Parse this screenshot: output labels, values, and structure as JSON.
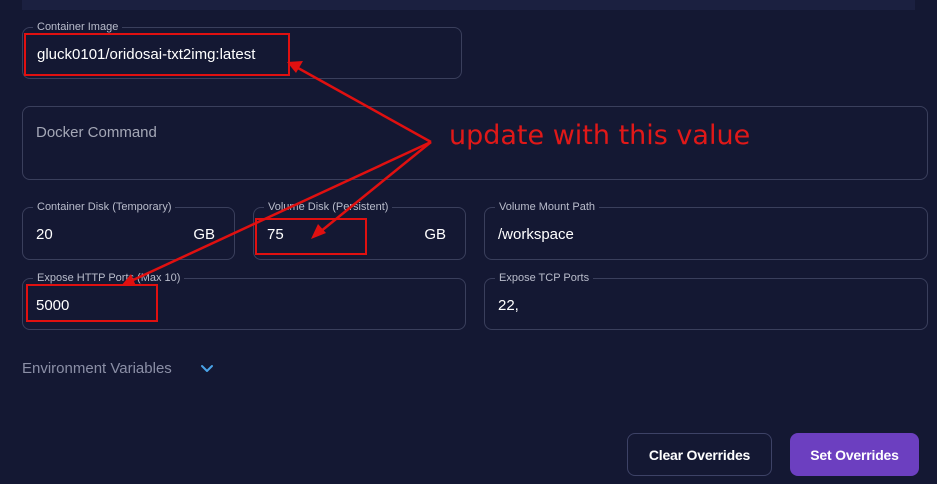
{
  "form": {
    "container_image": {
      "label": "Container Image",
      "value": "gluck0101/oridosai-txt2img:latest"
    },
    "docker_command": {
      "placeholder": "Docker Command"
    },
    "container_disk": {
      "label": "Container Disk (Temporary)",
      "value": "20",
      "unit": "GB"
    },
    "volume_disk": {
      "label": "Volume Disk (Persistent)",
      "value": "75",
      "unit": "GB"
    },
    "volume_mount_path": {
      "label": "Volume Mount Path",
      "value": "/workspace"
    },
    "http_ports": {
      "label": "Expose HTTP Ports (Max 10)",
      "value": "5000"
    },
    "tcp_ports": {
      "label": "Expose TCP Ports",
      "value": "22,"
    },
    "env_vars": {
      "label": "Environment Variables",
      "icon": "chevron-down-icon"
    }
  },
  "buttons": {
    "clear": "Clear Overrides",
    "set": "Set Overrides"
  },
  "annotation": {
    "text": "update with this value",
    "color": "#e01010"
  },
  "colors": {
    "background": "#141833",
    "border": "#3a3f5c",
    "accent": "#6c3fc0",
    "chevron": "#4aa3e8"
  }
}
